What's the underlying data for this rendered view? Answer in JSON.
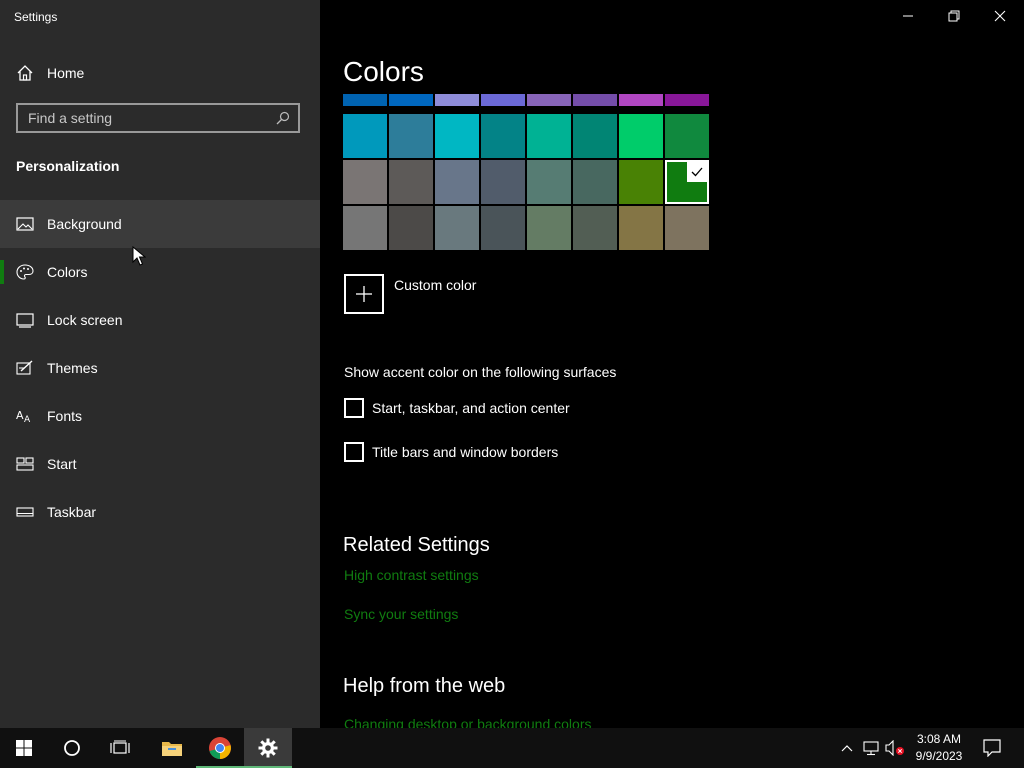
{
  "window": {
    "title": "Settings",
    "controls": [
      "minimize-icon",
      "restore-icon",
      "close-icon"
    ]
  },
  "sidebar": {
    "home_label": "Home",
    "search_placeholder": "Find a setting",
    "section": "Personalization",
    "items": [
      {
        "label": "Background",
        "icon": "picture-icon",
        "hover": true
      },
      {
        "label": "Colors",
        "icon": "palette-icon",
        "selected": true
      },
      {
        "label": "Lock screen",
        "icon": "lock-screen-icon"
      },
      {
        "label": "Themes",
        "icon": "brush-icon"
      },
      {
        "label": "Fonts",
        "icon": "font-icon"
      },
      {
        "label": "Start",
        "icon": "start-icon"
      },
      {
        "label": "Taskbar",
        "icon": "taskbar-icon"
      }
    ]
  },
  "main": {
    "title": "Colors",
    "swatch_rows": [
      [
        "#0063b1",
        "#0067c0",
        "#8e8cd8",
        "#6b69d6",
        "#8764b8",
        "#744da9",
        "#b146c2",
        "#881798"
      ],
      [
        "#0099bc",
        "#2d7d9a",
        "#00b7c3",
        "#038387",
        "#00b294",
        "#018574",
        "#00cc6a",
        "#10893e"
      ],
      [
        "#7a7574",
        "#5d5a58",
        "#68768a",
        "#515c6b",
        "#567c73",
        "#486860",
        "#498205",
        "#107c10"
      ],
      [
        "#767676",
        "#4c4a48",
        "#69797e",
        "#4a5459",
        "#647c64",
        "#525e54",
        "#847545",
        "#7e735f"
      ]
    ],
    "selected_color": "#107c10",
    "custom_color_label": "Custom color",
    "surfaces_label": "Show accent color on the following surfaces",
    "checkboxes": [
      {
        "label": "Start, taskbar, and action center",
        "checked": false
      },
      {
        "label": "Title bars and window borders",
        "checked": false
      }
    ],
    "related_title": "Related Settings",
    "related_links": [
      "High contrast settings",
      "Sync your settings"
    ],
    "help_title": "Help from the web",
    "help_links": [
      "Changing desktop or background colors"
    ],
    "accent_color": "#107c10"
  },
  "taskbar": {
    "apps": [
      "windows-start-icon",
      "cortana-icon",
      "task-view-icon",
      "file-explorer-icon",
      "chrome-icon",
      "settings-icon"
    ],
    "time": "3:08 AM",
    "date": "9/9/2023"
  }
}
